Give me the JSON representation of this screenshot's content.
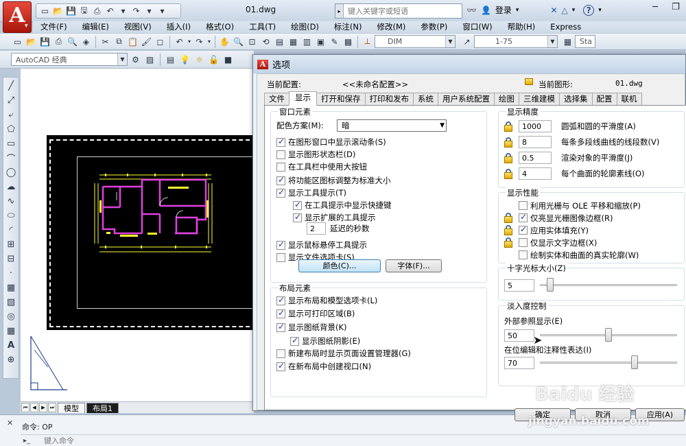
{
  "app": {
    "doc_title": "01.dwg",
    "search_placeholder": "键入关键字或短语",
    "login_label": "登录",
    "menus": [
      "文件(F)",
      "编辑(E)",
      "视图(V)",
      "插入(I)",
      "格式(O)",
      "工具(T)",
      "绘图(D)",
      "标注(N)",
      "修改(M)",
      "参数(P)",
      "窗口(W)",
      "帮助(H)",
      "Express"
    ],
    "dim_style": "DIM",
    "scale_value": "1-75",
    "style_partial": "Sta",
    "workspace": "AutoCAD 经典",
    "layout_tabs": [
      "模型",
      "布局1"
    ],
    "active_layout": "布局1",
    "command_history": "命令: OP",
    "command_placeholder": "键入命令",
    "accent_color": "#c0281a"
  },
  "dialog": {
    "title": "选项",
    "current_profile_label": "当前配置:",
    "current_profile_value": "<<未命名配置>>",
    "current_drawing_label": "当前图形:",
    "current_drawing_value": "01.dwg",
    "tabs": [
      "文件",
      "显示",
      "打开和保存",
      "打印和发布",
      "系统",
      "用户系统配置",
      "绘图",
      "三维建模",
      "选择集",
      "配置",
      "联机"
    ],
    "active_tab": "显示",
    "window_elements": {
      "title": "窗口元素",
      "color_scheme_label": "配色方案(M):",
      "color_scheme_value": "暗",
      "checkboxes": [
        {
          "label": "在图形窗口中显示滚动条(S)",
          "checked": true
        },
        {
          "label": "显示图形状态栏(D)",
          "checked": false
        },
        {
          "label": "在工具栏中使用大按钮",
          "checked": false
        },
        {
          "label": "将功能区图标调整为标准大小",
          "checked": true
        },
        {
          "label": "显示工具提示(T)",
          "checked": true
        },
        {
          "label": "在工具提示中显示快捷键",
          "checked": true
        },
        {
          "label": "显示扩展的工具提示",
          "checked": true
        },
        {
          "label": "显示鼠标悬停工具提示",
          "checked": true
        },
        {
          "label": "显示文件选项卡(S)",
          "checked": false
        }
      ],
      "delay_value": "2",
      "delay_label": "延迟的秒数",
      "colors_button": "颜色(C)...",
      "fonts_button": "字体(F)..."
    },
    "layout_elements": {
      "title": "布局元素",
      "checkboxes": [
        {
          "label": "显示布局和模型选项卡(L)",
          "checked": true
        },
        {
          "label": "显示可打印区域(B)",
          "checked": true
        },
        {
          "label": "显示图纸背景(K)",
          "checked": true
        },
        {
          "label": "显示图纸阴影(E)",
          "checked": true
        },
        {
          "label": "新建布局时显示页面设置管理器(G)",
          "checked": false
        },
        {
          "label": "在新布局中创建视口(N)",
          "checked": true
        }
      ]
    },
    "display_resolution": {
      "title": "显示精度",
      "items": [
        {
          "value": "1000",
          "label": "圆弧和圆的平滑度(A)"
        },
        {
          "value": "8",
          "label": "每条多段线曲线的线段数(V)"
        },
        {
          "value": "0.5",
          "label": "渲染对象的平滑度(J)"
        },
        {
          "value": "4",
          "label": "每个曲面的轮廓素线(O)"
        }
      ]
    },
    "display_performance": {
      "title": "显示性能",
      "items": [
        {
          "label": "利用光栅与 OLE 平移和缩放(P)",
          "checked": false,
          "locked": false
        },
        {
          "label": "仅亮显光栅图像边框(R)",
          "checked": true,
          "locked": true
        },
        {
          "label": "应用实体填充(Y)",
          "checked": true,
          "locked": true
        },
        {
          "label": "仅显示文字边框(X)",
          "checked": false,
          "locked": true
        },
        {
          "label": "绘制实体和曲面的真实轮廓(W)",
          "checked": false,
          "locked": false
        }
      ]
    },
    "crosshair": {
      "title": "十字光标大小(Z)",
      "value": "5",
      "level_fraction": 0.05
    },
    "fade_control": {
      "title": "淡入度控制",
      "xref_label": "外部参照显示(E)",
      "xref_value": "50",
      "xref_fraction": 0.5,
      "inplace_label": "在位编辑和注释性表达(I)",
      "inplace_value": "70",
      "inplace_fraction": 0.7
    },
    "buttons": {
      "ok": "确定",
      "cancel": "取消",
      "apply": "应用(A)"
    }
  },
  "watermark": {
    "logo": "Baidu 经验",
    "url": "jingyan.baidu.com"
  }
}
